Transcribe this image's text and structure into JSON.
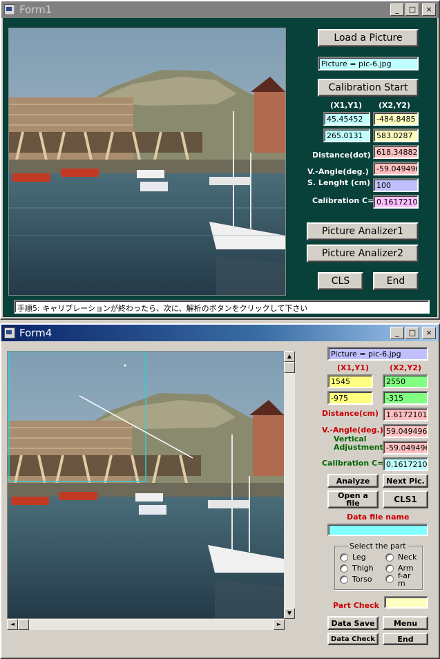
{
  "form1": {
    "title": "Form1",
    "load_button": "Load a Picture",
    "picture_field": "Picture = pic-6.jpg",
    "calibration_button": "Calibration Start",
    "x1y1_header": "(X1,Y1)",
    "x2y2_header": "(X2,Y2)",
    "x1_value": "45.45452",
    "x2_value": "-484.8485",
    "y1_value": "265.0131",
    "y2_value": "583.0287",
    "distance_label": "Distance(dot)",
    "distance_value": "618.3488262",
    "vangle_label": "V.-Angle(deg.)",
    "vangle_value": "-59.0494968",
    "slength_label": "S. Lenght (cm)",
    "slength_value": "100",
    "calibration_label": "Calibration C=",
    "calibration_value": "0.16172101",
    "analizer1_button": "Picture Analizer1",
    "analizer2_button": "Picture Analizer2",
    "cls_button": "CLS",
    "end_button": "End",
    "status_text": "手順5: キャリブレーションが終わったら、次に、解析のボタンをクリックして下さい",
    "window_buttons": {
      "minimize": "_",
      "maximize": "□",
      "close": "×"
    }
  },
  "form4": {
    "title": "Form4",
    "picture_field": "Picture = pic-6.jpg",
    "x1y1_header": "(X1,Y1)",
    "x2y2_header": "(X2,Y2)",
    "x1_value": "1545",
    "x2_value": "2550",
    "y1_value": "-975",
    "y2_value": "-315",
    "distance_label": "Distance(cm)",
    "distance_value": "1.61721015",
    "vangle_label": "V.-Angle(deg.)",
    "vangle_value": "59.0494968",
    "vertical_label_1": "Vertical",
    "vertical_label_2": "Adjustment",
    "vertical_value": "-59.0494968",
    "calibration_label": "Calibration C=",
    "calibration_value": "0.16172101",
    "analyze_button": "Analyze",
    "next_button": "Next Pic.",
    "open_file_button_1": "Open a",
    "open_file_button_2": "file",
    "cls1_button": "CLS1",
    "data_file_label": "Data file name",
    "data_file_value": "",
    "group_label": "Select the part",
    "parts": {
      "leg": "Leg",
      "neck": "Neck",
      "thigh": "Thigh",
      "arm": "Arm",
      "torso": "Torso",
      "forearm_1": "f-ar",
      "forearm_2": "m"
    },
    "part_check_label": "Part Check",
    "part_check_value": "",
    "data_save_button": "Data Save",
    "menu_button": "Menu",
    "data_check_button": "Data Check",
    "end_button": "End",
    "window_buttons": {
      "minimize": "_",
      "maximize": "□",
      "close": "×"
    },
    "scroll": {
      "left": "◄",
      "right": "►",
      "up": "▲",
      "down": "▼"
    }
  },
  "colors": {
    "form1_bg": "#08403a",
    "title_active": "#0a246a",
    "title_inactive": "#808080",
    "cyan_field": "#c0ffff",
    "yellow_field": "#ffffc0",
    "pink_field": "#ffc0c0",
    "lavender_field": "#c0c0ff",
    "green_field": "#80ff80",
    "pink_vivid": "#ffc0ff"
  }
}
